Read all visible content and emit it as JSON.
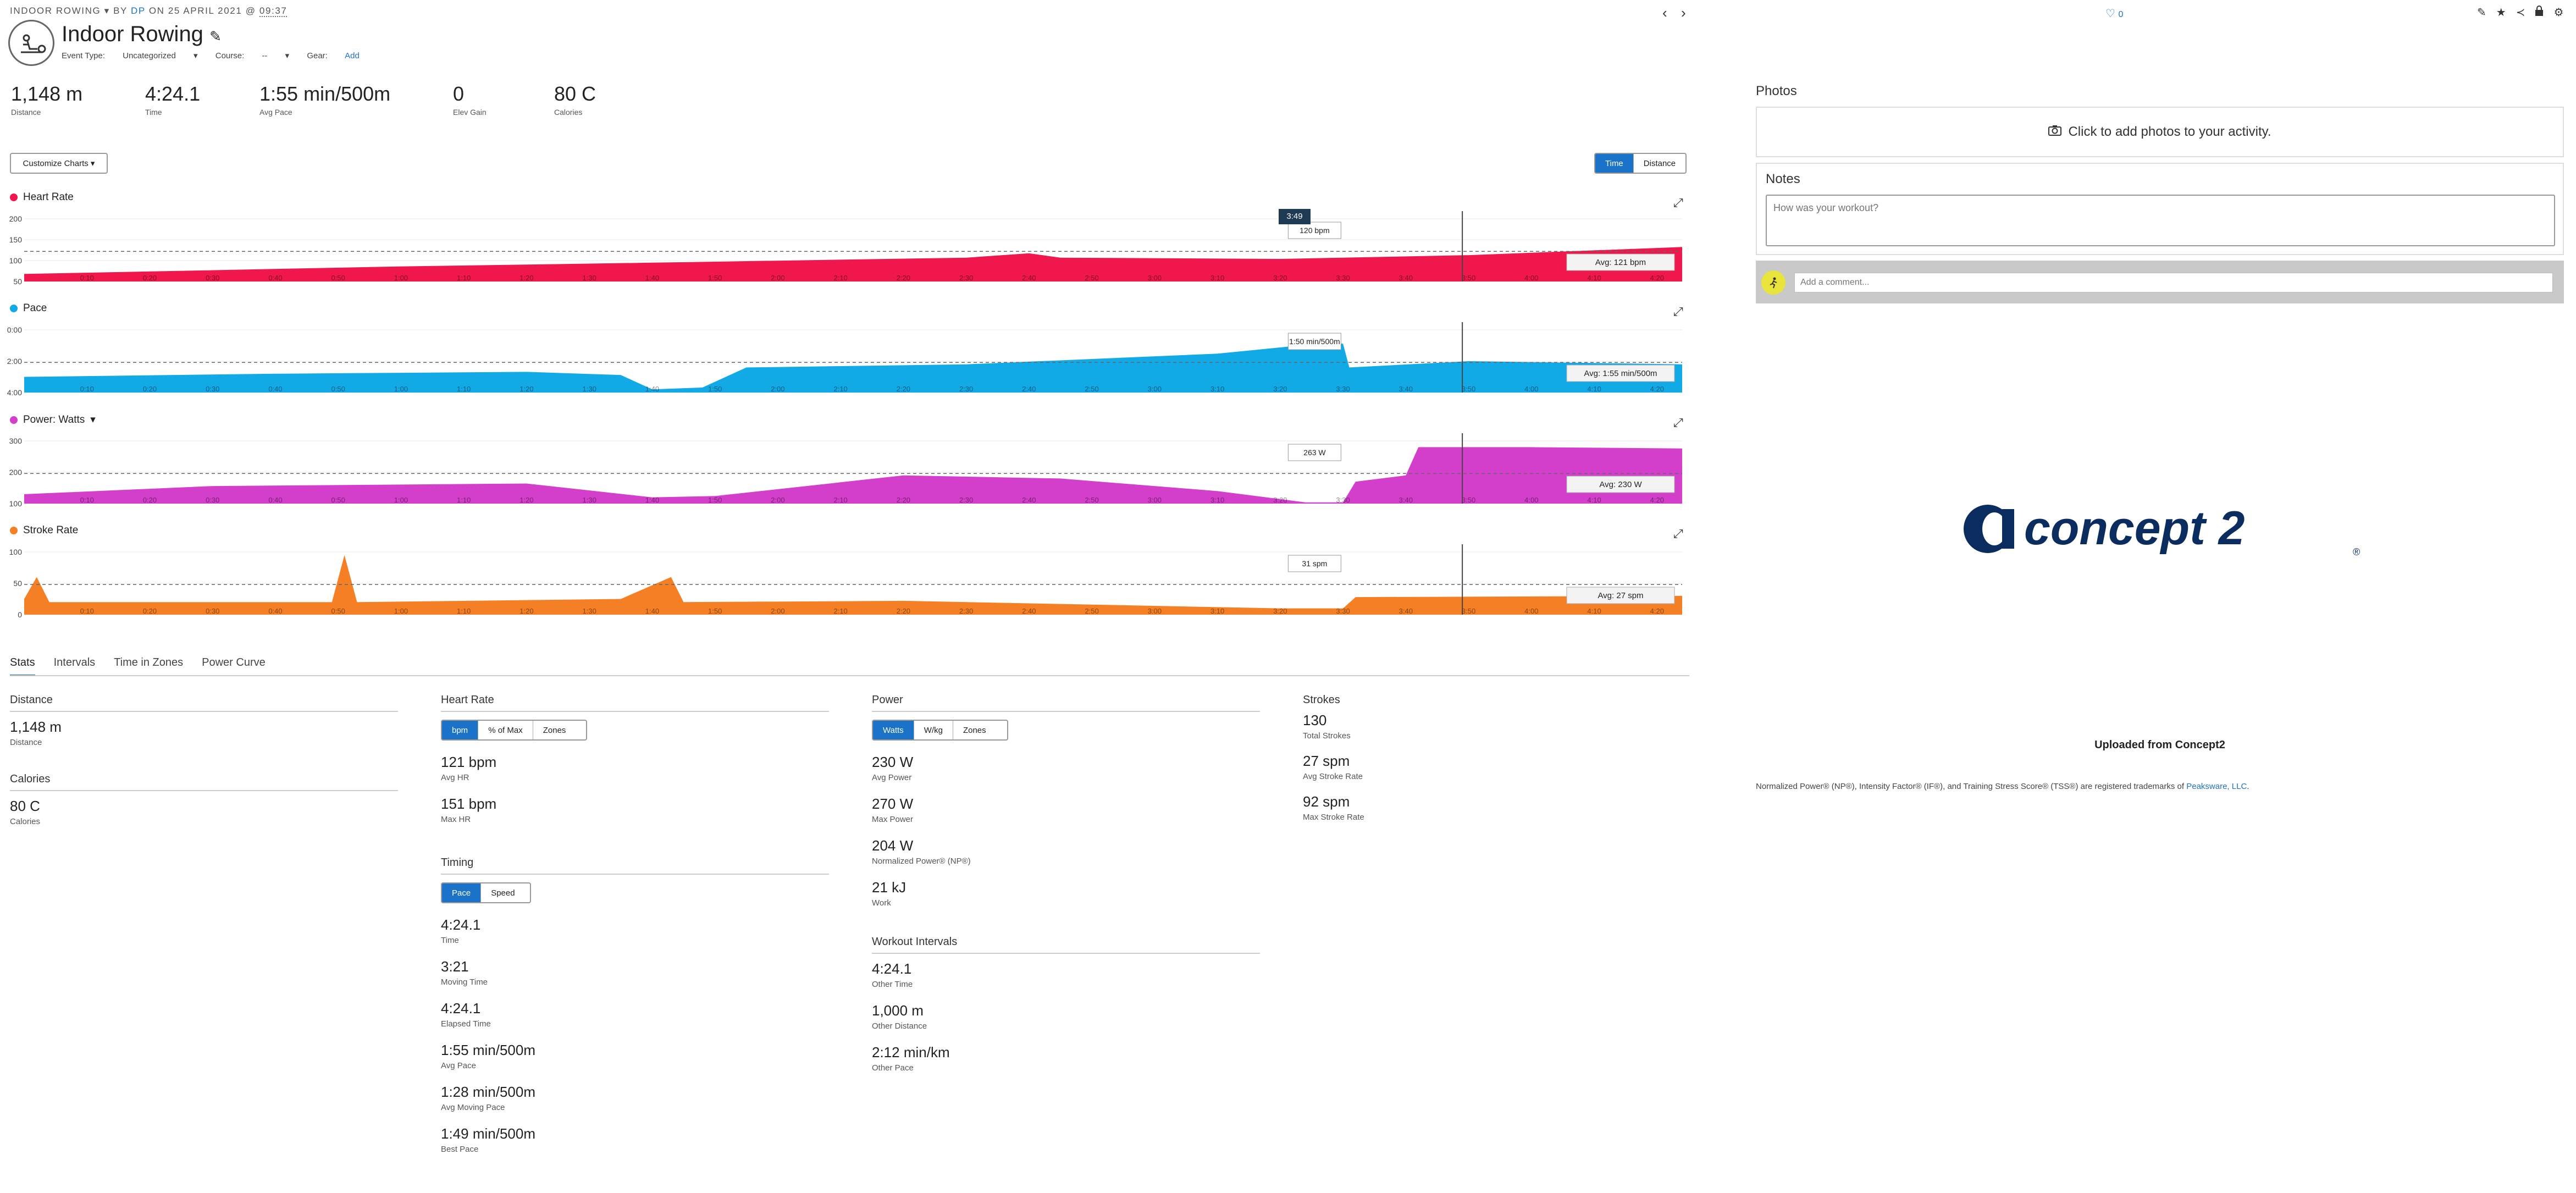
{
  "header": {
    "activity_type": "INDOOR ROWING",
    "by": "BY",
    "author": "DP",
    "on": "ON 25 APRIL 2021 @",
    "time": "09:37",
    "title": "Indoor Rowing",
    "event_type_label": "Event Type:",
    "event_type_value": "Uncategorized",
    "course_label": "Course:",
    "course_value": "--",
    "gear_label": "Gear:",
    "gear_value": "Add",
    "likes": "0"
  },
  "summary": [
    {
      "value": "1,148 m",
      "label": "Distance"
    },
    {
      "value": "4:24.1",
      "label": "Time"
    },
    {
      "value": "1:55 min/500m",
      "label": "Avg Pace"
    },
    {
      "value": "0",
      "label": "Elev Gain"
    },
    {
      "value": "80 C",
      "label": "Calories"
    }
  ],
  "controls": {
    "customize": "Customize Charts",
    "toggle": [
      "Time",
      "Distance"
    ]
  },
  "charts": {
    "time_ticks": [
      "0:10",
      "0:20",
      "0:30",
      "0:40",
      "0:50",
      "1:00",
      "1:10",
      "1:20",
      "1:30",
      "1:40",
      "1:50",
      "2:00",
      "2:10",
      "2:20",
      "2:30",
      "2:40",
      "2:50",
      "3:00",
      "3:10",
      "3:20",
      "3:30",
      "3:40",
      "3:50",
      "4:00",
      "4:10",
      "4:20"
    ],
    "cursor_time": "3:49",
    "heart_rate": {
      "title": "Heart Rate",
      "color": "#f0174d",
      "yticks": [
        "200",
        "150",
        "100",
        "50"
      ],
      "avg": "Avg: 121 bpm",
      "hover": "120 bpm"
    },
    "pace": {
      "title": "Pace",
      "color": "#11a9e6",
      "yticks": [
        "0:00",
        "2:00",
        "4:00"
      ],
      "avg": "Avg: 1:55 min/500m",
      "hover": "1:50 min/500m"
    },
    "power": {
      "title": "Power: Watts",
      "color": "#d33fcb",
      "yticks": [
        "300",
        "200",
        "100"
      ],
      "avg": "Avg: 230 W",
      "hover": "263 W"
    },
    "stroke": {
      "title": "Stroke Rate",
      "color": "#f57f24",
      "yticks": [
        "100",
        "50",
        "0"
      ],
      "avg": "Avg: 27 spm",
      "hover": "31 spm"
    }
  },
  "tabs": [
    "Stats",
    "Intervals",
    "Time in Zones",
    "Power Curve"
  ],
  "stats": {
    "distance": {
      "title": "Distance",
      "value": "1,148 m",
      "label": "Distance"
    },
    "calories": {
      "title": "Calories",
      "value": "80 C",
      "label": "Calories"
    },
    "heart_rate": {
      "title": "Heart Rate",
      "seg": [
        "bpm",
        "% of Max",
        "Zones"
      ],
      "items": [
        {
          "value": "121 bpm",
          "label": "Avg HR"
        },
        {
          "value": "151 bpm",
          "label": "Max HR"
        }
      ]
    },
    "timing": {
      "title": "Timing",
      "seg": [
        "Pace",
        "Speed"
      ],
      "items": [
        {
          "value": "4:24.1",
          "label": "Time"
        },
        {
          "value": "3:21",
          "label": "Moving Time"
        },
        {
          "value": "4:24.1",
          "label": "Elapsed Time"
        },
        {
          "value": "1:55 min/500m",
          "label": "Avg Pace"
        },
        {
          "value": "1:28 min/500m",
          "label": "Avg Moving Pace"
        },
        {
          "value": "1:49 min/500m",
          "label": "Best Pace"
        }
      ]
    },
    "power": {
      "title": "Power",
      "seg": [
        "Watts",
        "W/kg",
        "Zones"
      ],
      "items": [
        {
          "value": "230 W",
          "label": "Avg Power"
        },
        {
          "value": "270 W",
          "label": "Max Power"
        },
        {
          "value": "204 W",
          "label": "Normalized Power® (NP®)"
        },
        {
          "value": "21 kJ",
          "label": "Work"
        }
      ]
    },
    "workout_intervals": {
      "title": "Workout Intervals",
      "items": [
        {
          "value": "4:24.1",
          "label": "Other Time"
        },
        {
          "value": "1,000 m",
          "label": "Other Distance"
        },
        {
          "value": "2:12 min/km",
          "label": "Other Pace"
        }
      ]
    },
    "strokes": {
      "title": "Strokes",
      "items": [
        {
          "value": "130",
          "label": "Total Strokes"
        },
        {
          "value": "27 spm",
          "label": "Avg Stroke Rate"
        },
        {
          "value": "92 spm",
          "label": "Max Stroke Rate"
        }
      ]
    }
  },
  "right": {
    "photos_title": "Photos",
    "photos_cta": "Click to add photos to your activity.",
    "notes_title": "Notes",
    "notes_placeholder": "How was your workout?",
    "comment_placeholder": "Add a comment...",
    "logo_text": "concept 2",
    "uploaded": "Uploaded from Concept2",
    "trademark_text": "Normalized Power® (NP®), Intensity Factor® (IF®), and Training Stress Score® (TSS®) are registered trademarks of",
    "trademark_link": "Peaksware, LLC",
    "trademark_end": "."
  },
  "icons": {
    "like": "heart-icon",
    "edit": "pencil-icon",
    "star": "star-icon",
    "share": "share-icon",
    "lock": "lock-icon",
    "settings": "gear-icon",
    "prev": "chevron-left-icon",
    "next": "chevron-right-icon",
    "camera": "camera-icon",
    "expand": "expand-icon",
    "activity": "rowing-icon"
  }
}
